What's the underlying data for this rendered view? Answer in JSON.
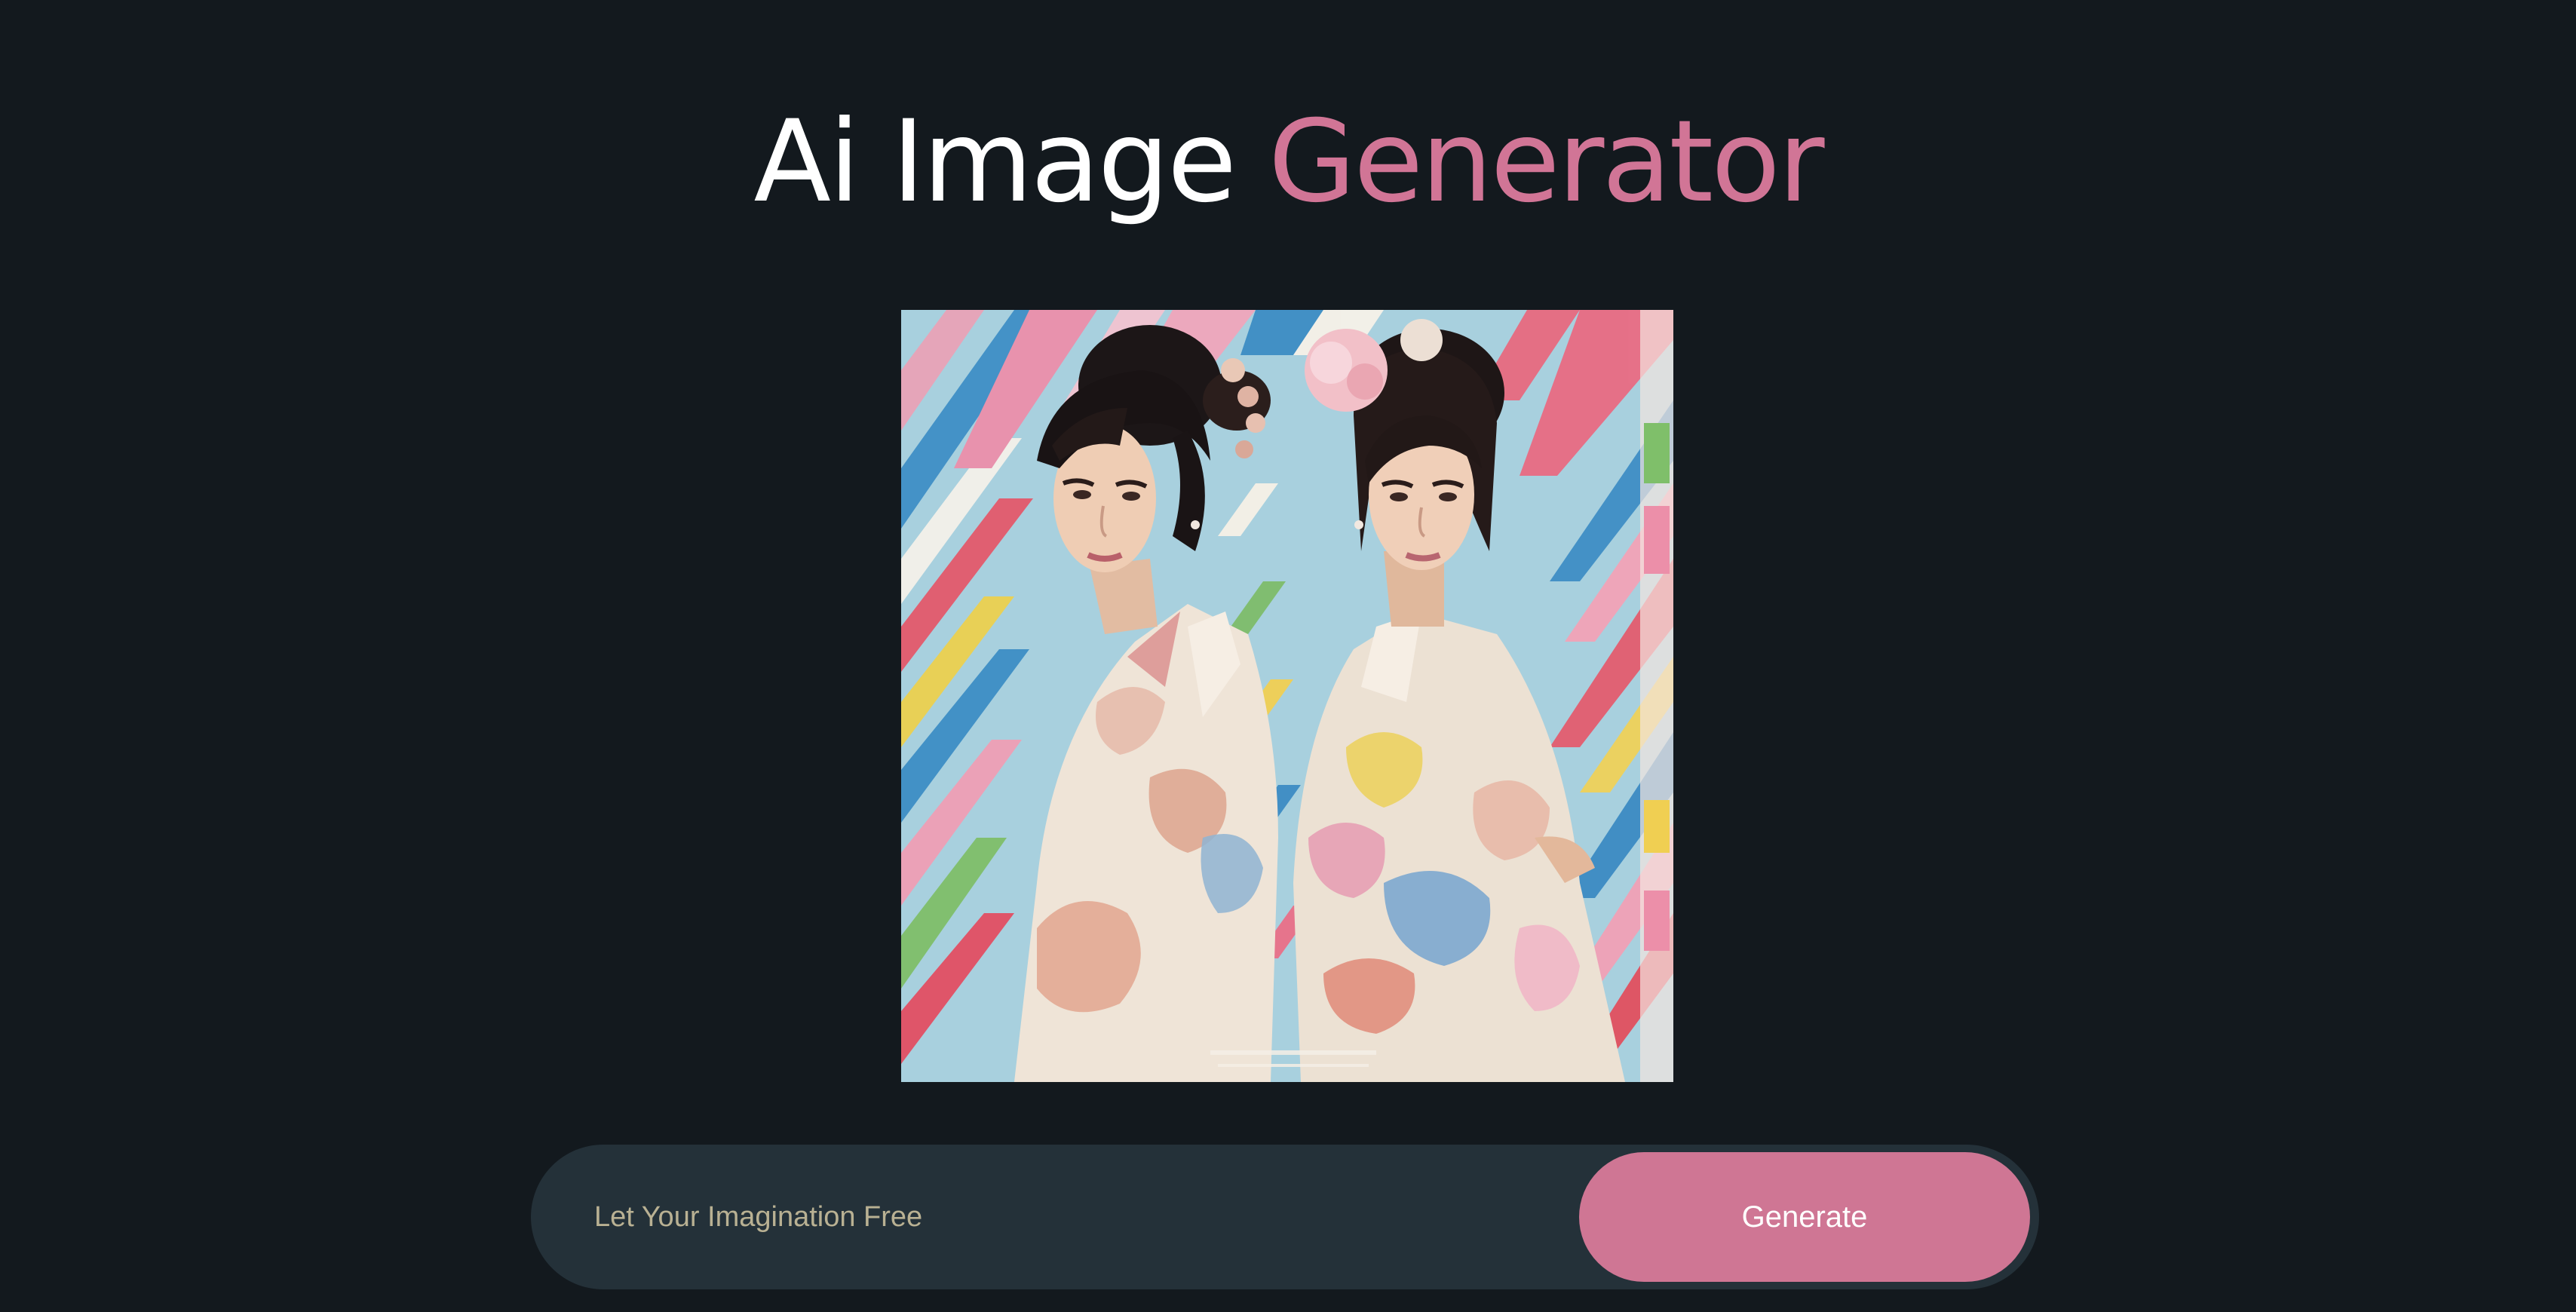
{
  "header": {
    "title_part1": "Ai Image",
    "title_part2": "Generator"
  },
  "preview": {
    "alt": "Generated image of two women in pastel kimonos against a colorful geometric background"
  },
  "prompt": {
    "placeholder": "Let Your Imagination Free",
    "value": ""
  },
  "actions": {
    "generate_label": "Generate"
  },
  "colors": {
    "background": "#13191e",
    "accent": "#d17596",
    "input_bg": "#243139",
    "placeholder": "#b9b193"
  }
}
